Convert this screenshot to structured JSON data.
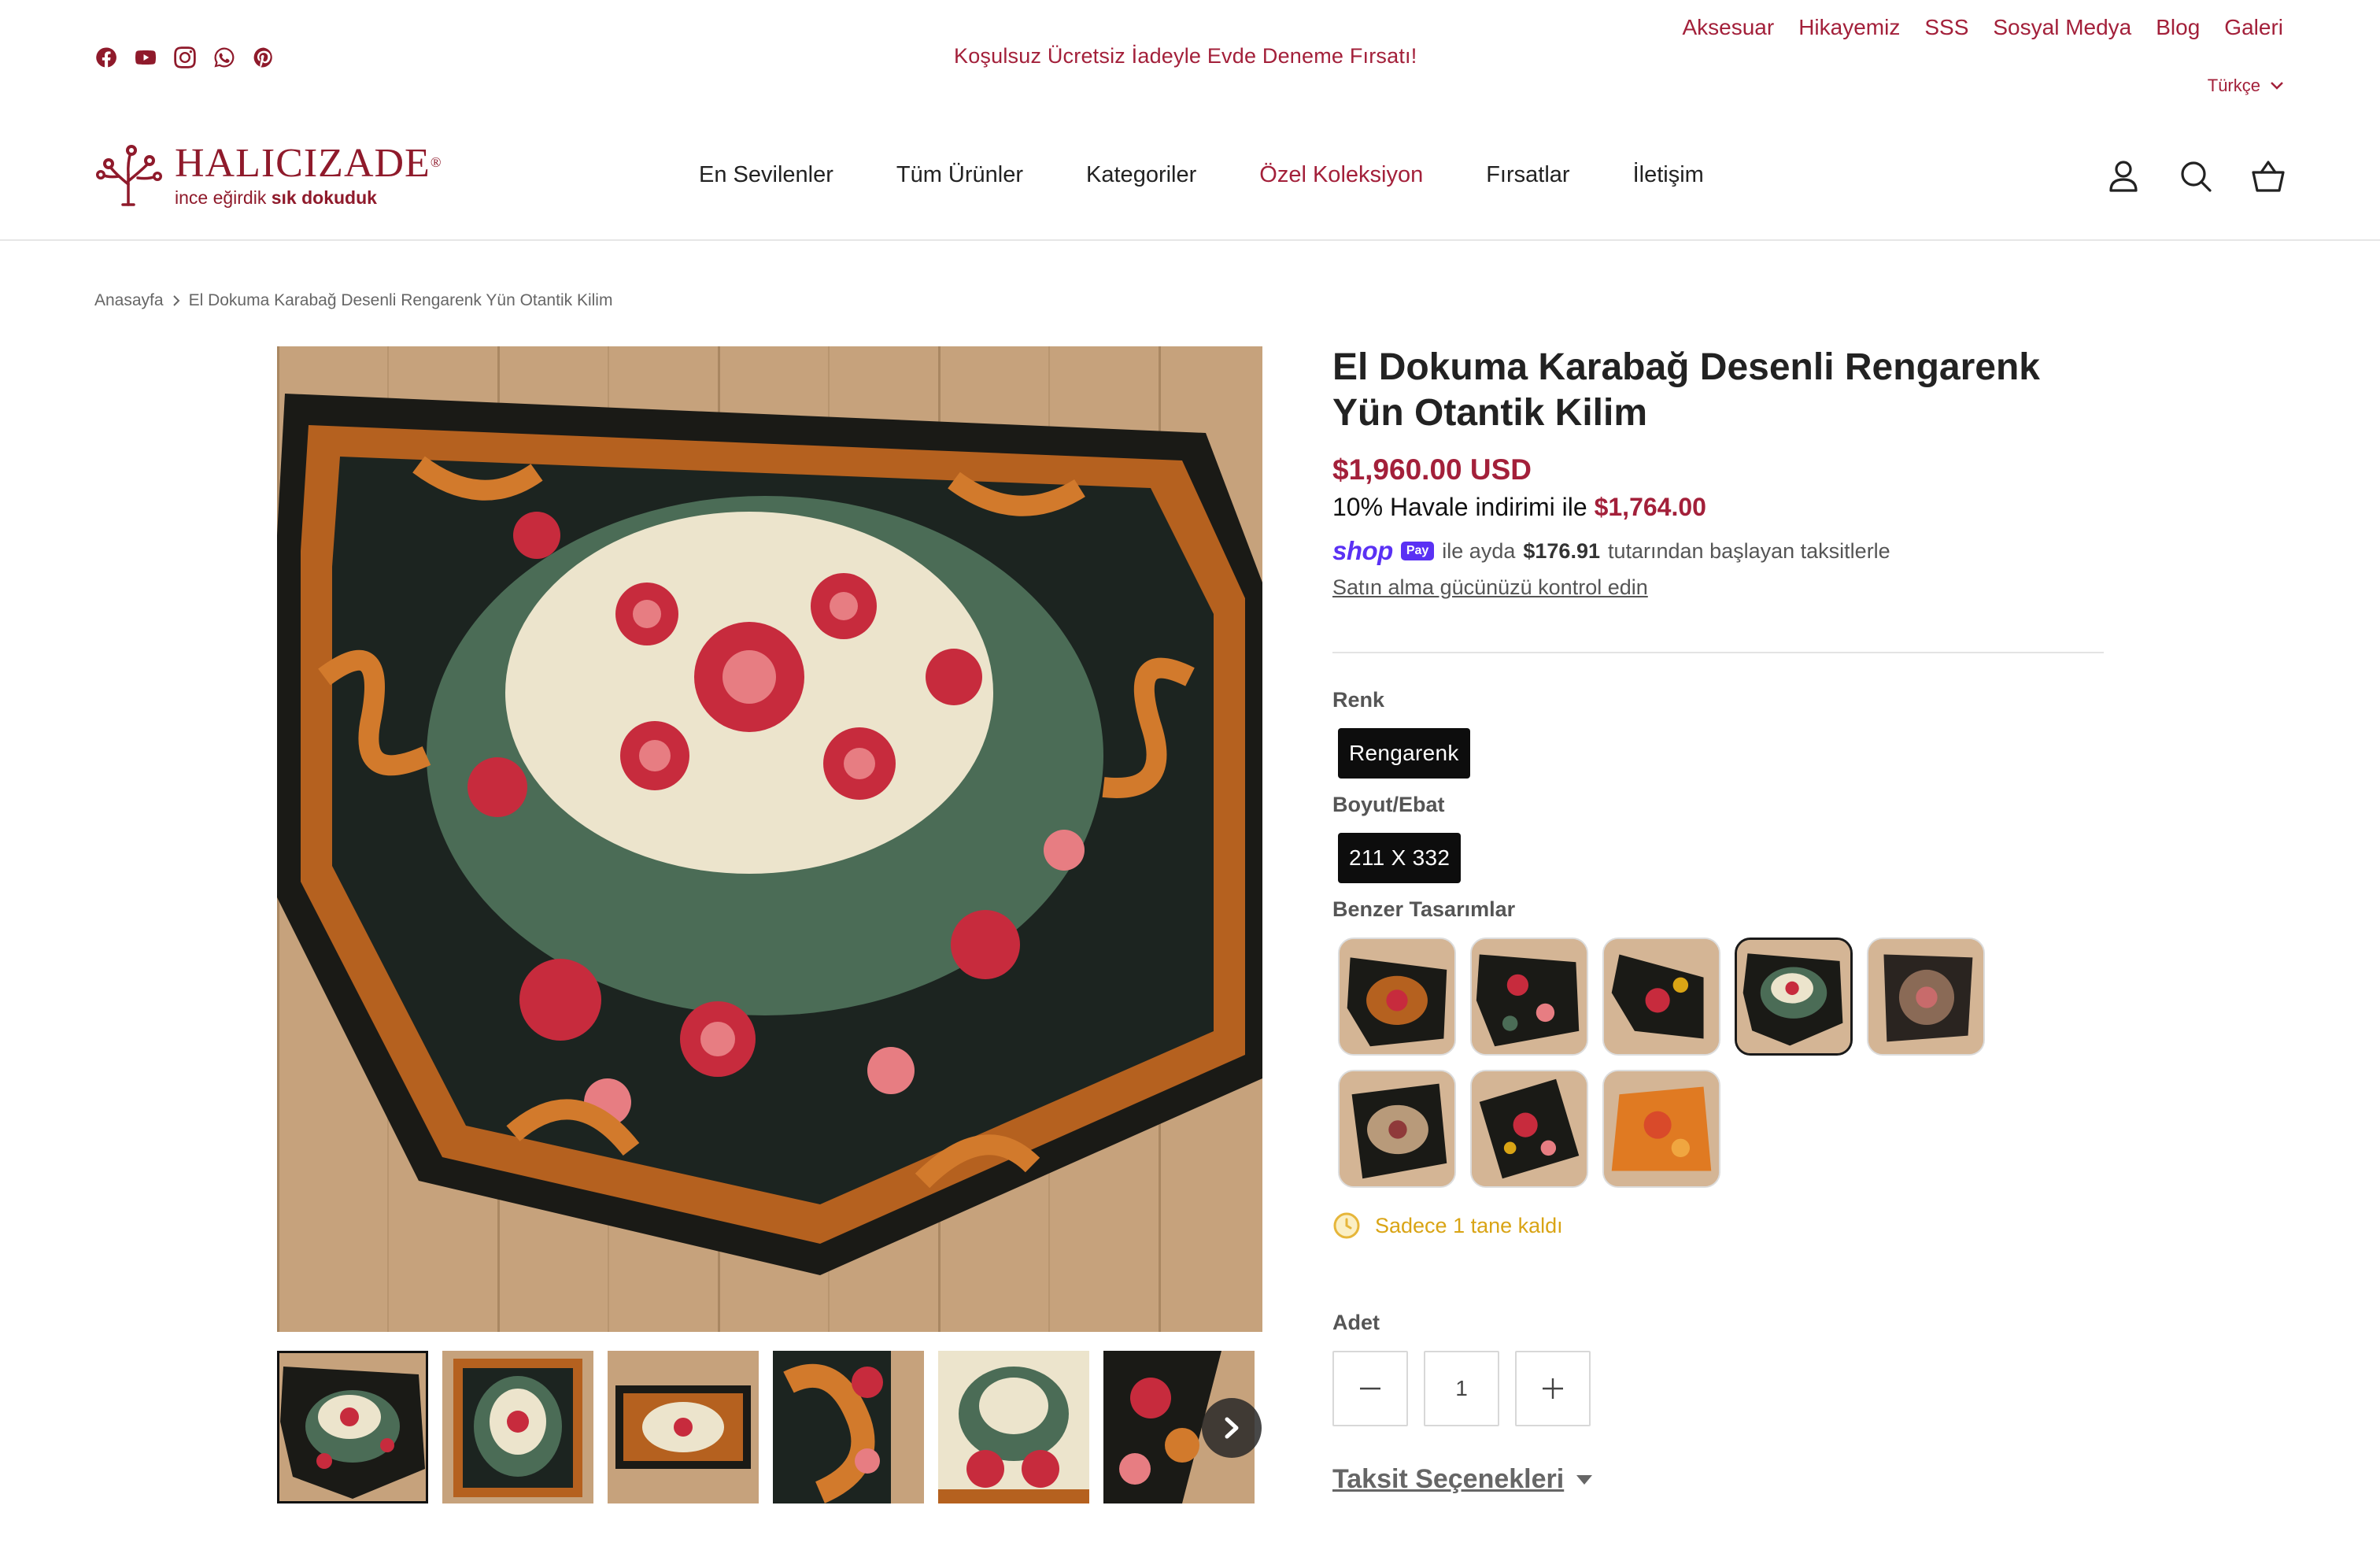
{
  "topbar": {
    "social": [
      "facebook-icon",
      "youtube-icon",
      "instagram-icon",
      "whatsapp-icon",
      "pinterest-icon"
    ],
    "announcement": "Koşulsuz Ücretsiz İadeyle Evde Deneme Fırsatı!",
    "links": [
      "Aksesuar",
      "Hikayemiz",
      "SSS",
      "Sosyal Medya",
      "Blog",
      "Galeri"
    ],
    "language": "Türkçe"
  },
  "header": {
    "brand": "HALICIZADE",
    "registered": "®",
    "tagline_start": "ince eğirdik ",
    "tagline_bold": "sık dokuduk",
    "nav": [
      "En Sevilenler",
      "Tüm Ürünler",
      "Kategoriler",
      "Özel Koleksiyon",
      "Fırsatlar",
      "İletişim"
    ],
    "active_nav": "Özel Koleksiyon",
    "icons": [
      "account-icon",
      "search-icon",
      "cart-icon"
    ]
  },
  "breadcrumb": {
    "home": "Anasayfa",
    "current": "El Dokuma Karabağ Desenli Rengarenk Yün Otantik Kilim"
  },
  "product": {
    "title": "El Dokuma Karabağ Desenli Rengarenk Yün Otantik Kilim",
    "price": "$1,960.00 USD",
    "discount_text": "10% Havale indirimi ile ",
    "discount_price": "$1,764.00",
    "shoppay": {
      "shop": "shop",
      "pay": "Pay",
      "before": "ile ayda",
      "amount": "$176.91",
      "after": "tutarından başlayan taksitlerle"
    },
    "check_link": "Satın alma gücünüzü kontrol edin",
    "color_label": "Renk",
    "color_value": "Rengarenk",
    "size_label": "Boyut/Ebat",
    "size_value": "211 X 332",
    "similar_label": "Benzer Tasarımlar",
    "similar_count": 8,
    "similar_selected_index": 3,
    "stock_text": "Sadece 1 tane kaldı",
    "qty_label": "Adet",
    "qty_value": "1",
    "installments_label": "Taksit Seçenekleri"
  },
  "gallery": {
    "thumb_count": 6,
    "selected_thumb": 0
  },
  "colors": {
    "brand": "#8f1a2b",
    "accent": "#a3203a",
    "stock": "#d9a415",
    "shoppay": "#5a31f4"
  }
}
